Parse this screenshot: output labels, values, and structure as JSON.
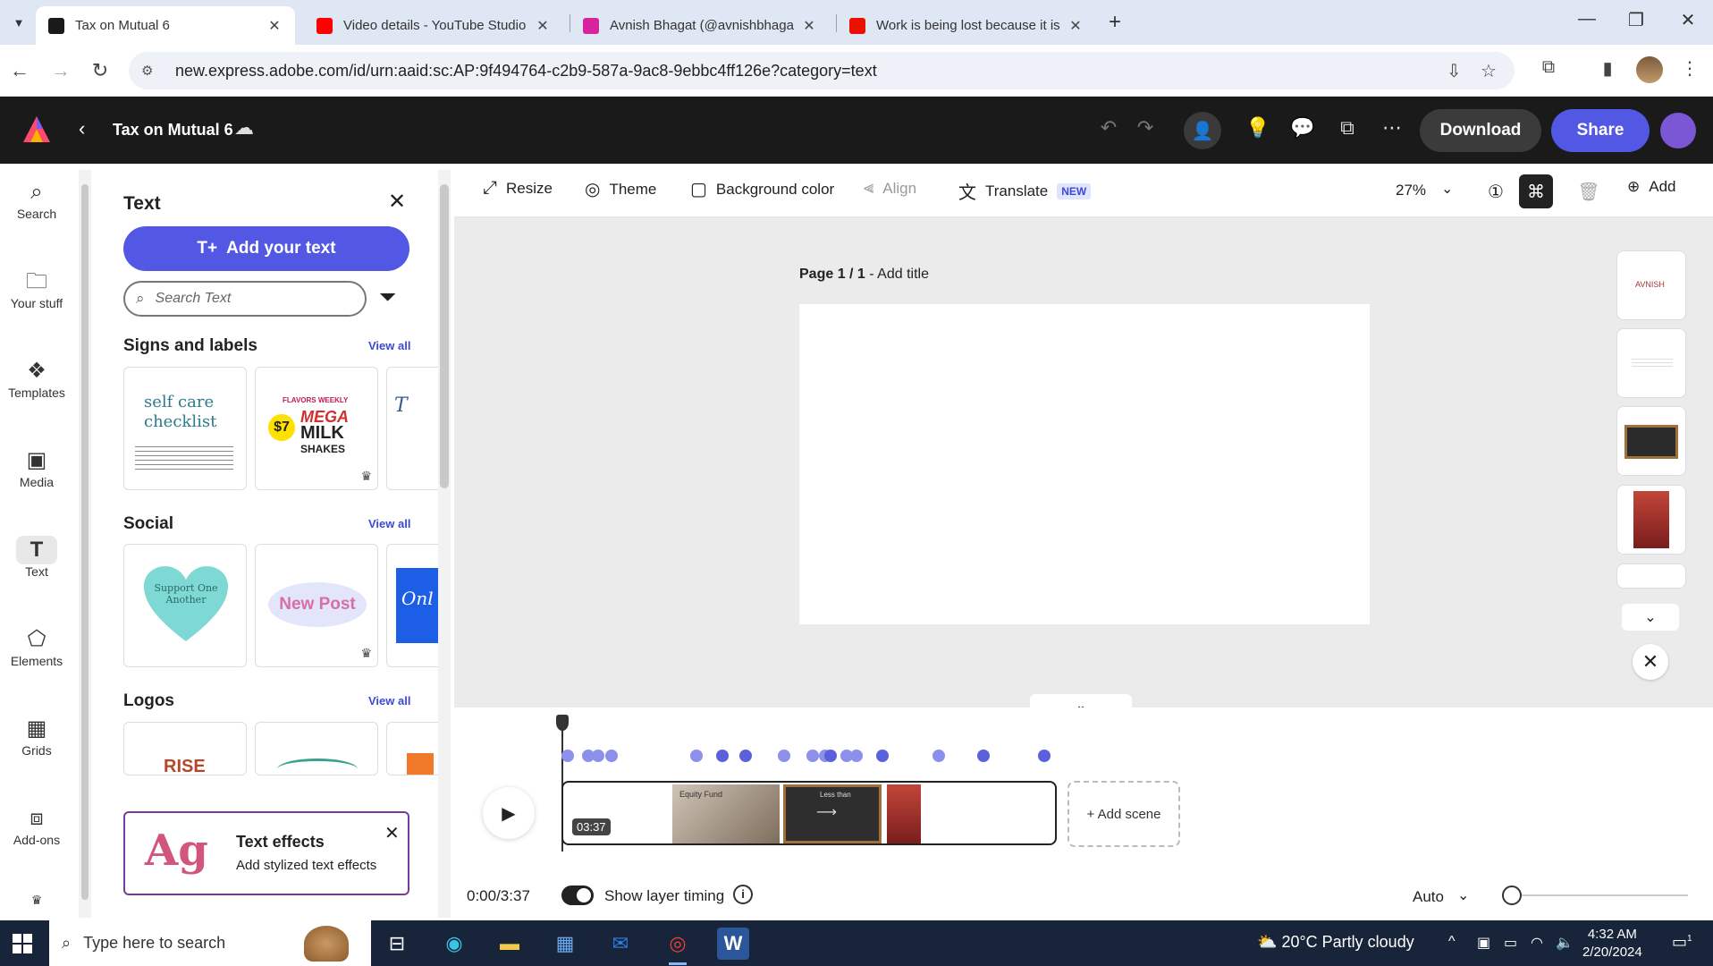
{
  "browser": {
    "tabs": [
      {
        "title": "Tax on Mutual 6",
        "favicon": "adobe-express-icon",
        "color": "#1a1a1a"
      },
      {
        "title": "Video details - YouTube Studio",
        "favicon": "youtube-icon",
        "color": "#ff0000"
      },
      {
        "title": "Avnish Bhagat (@avnishbhagat",
        "favicon": "instagram-icon",
        "color": "#d6249f"
      },
      {
        "title": "Work is being lost because it is",
        "favicon": "adobe-icon",
        "color": "#eb1000"
      }
    ],
    "url": "new.express.adobe.com/id/urn:aaid:sc:AP:9f494764-c2b9-587a-9ac8-9ebbc4ff126e?category=text"
  },
  "app": {
    "doc_title": "Tax on Mutual 6",
    "download_label": "Download",
    "share_label": "Share",
    "accent": "#5258e4"
  },
  "rail": [
    {
      "label": "Search",
      "icon": "search-icon"
    },
    {
      "label": "Your stuff",
      "icon": "folder-icon"
    },
    {
      "label": "Templates",
      "icon": "templates-icon"
    },
    {
      "label": "Media",
      "icon": "media-icon"
    },
    {
      "label": "Text",
      "icon": "text-icon",
      "active": true
    },
    {
      "label": "Elements",
      "icon": "elements-icon"
    },
    {
      "label": "Grids",
      "icon": "grids-icon"
    },
    {
      "label": "Add-ons",
      "icon": "addons-icon"
    }
  ],
  "panel": {
    "title": "Text",
    "add_text_label": "Add your text",
    "search_placeholder": "Search Text",
    "sections": [
      {
        "title": "Signs and labels",
        "view_all": "View all"
      },
      {
        "title": "Social",
        "view_all": "View all"
      },
      {
        "title": "Logos",
        "view_all": "View all"
      }
    ],
    "cards": {
      "self_care": [
        "self",
        "care",
        "checklist"
      ],
      "milk": {
        "price": "$7",
        "line1": "MEGA",
        "line2": "MILK",
        "line3": "SHAKES",
        "top": "FLAVORS WEEKLY"
      },
      "heart": "Support One Another",
      "new_post": "New Post",
      "onl": "Onl",
      "rise": "RISE"
    },
    "effects": {
      "glyph": "Ag",
      "title": "Text effects",
      "subtitle": "Add stylized text effects"
    }
  },
  "toolbar": {
    "resize": "Resize",
    "theme": "Theme",
    "background_color": "Background color",
    "align": "Align",
    "translate": "Translate",
    "new_badge": "NEW",
    "zoom": "27%",
    "add": "Add"
  },
  "canvas": {
    "page_label": "Page 1 / 1",
    "add_title": " - Add title",
    "thumb_text": "AVNISH"
  },
  "timeline": {
    "duration_badge": "03:37",
    "add_scene": "+ Add scene",
    "time": "0:00/3:37",
    "show_layer_timing": "Show layer timing",
    "auto": "Auto",
    "scene1_text": "Equity Fund",
    "scene2_text": "Less than"
  },
  "taskbar": {
    "search_placeholder": "Type here to search",
    "weather": "20°C  Partly cloudy",
    "time": "4:32 AM",
    "date": "2/20/2024",
    "notification_count": "1"
  }
}
